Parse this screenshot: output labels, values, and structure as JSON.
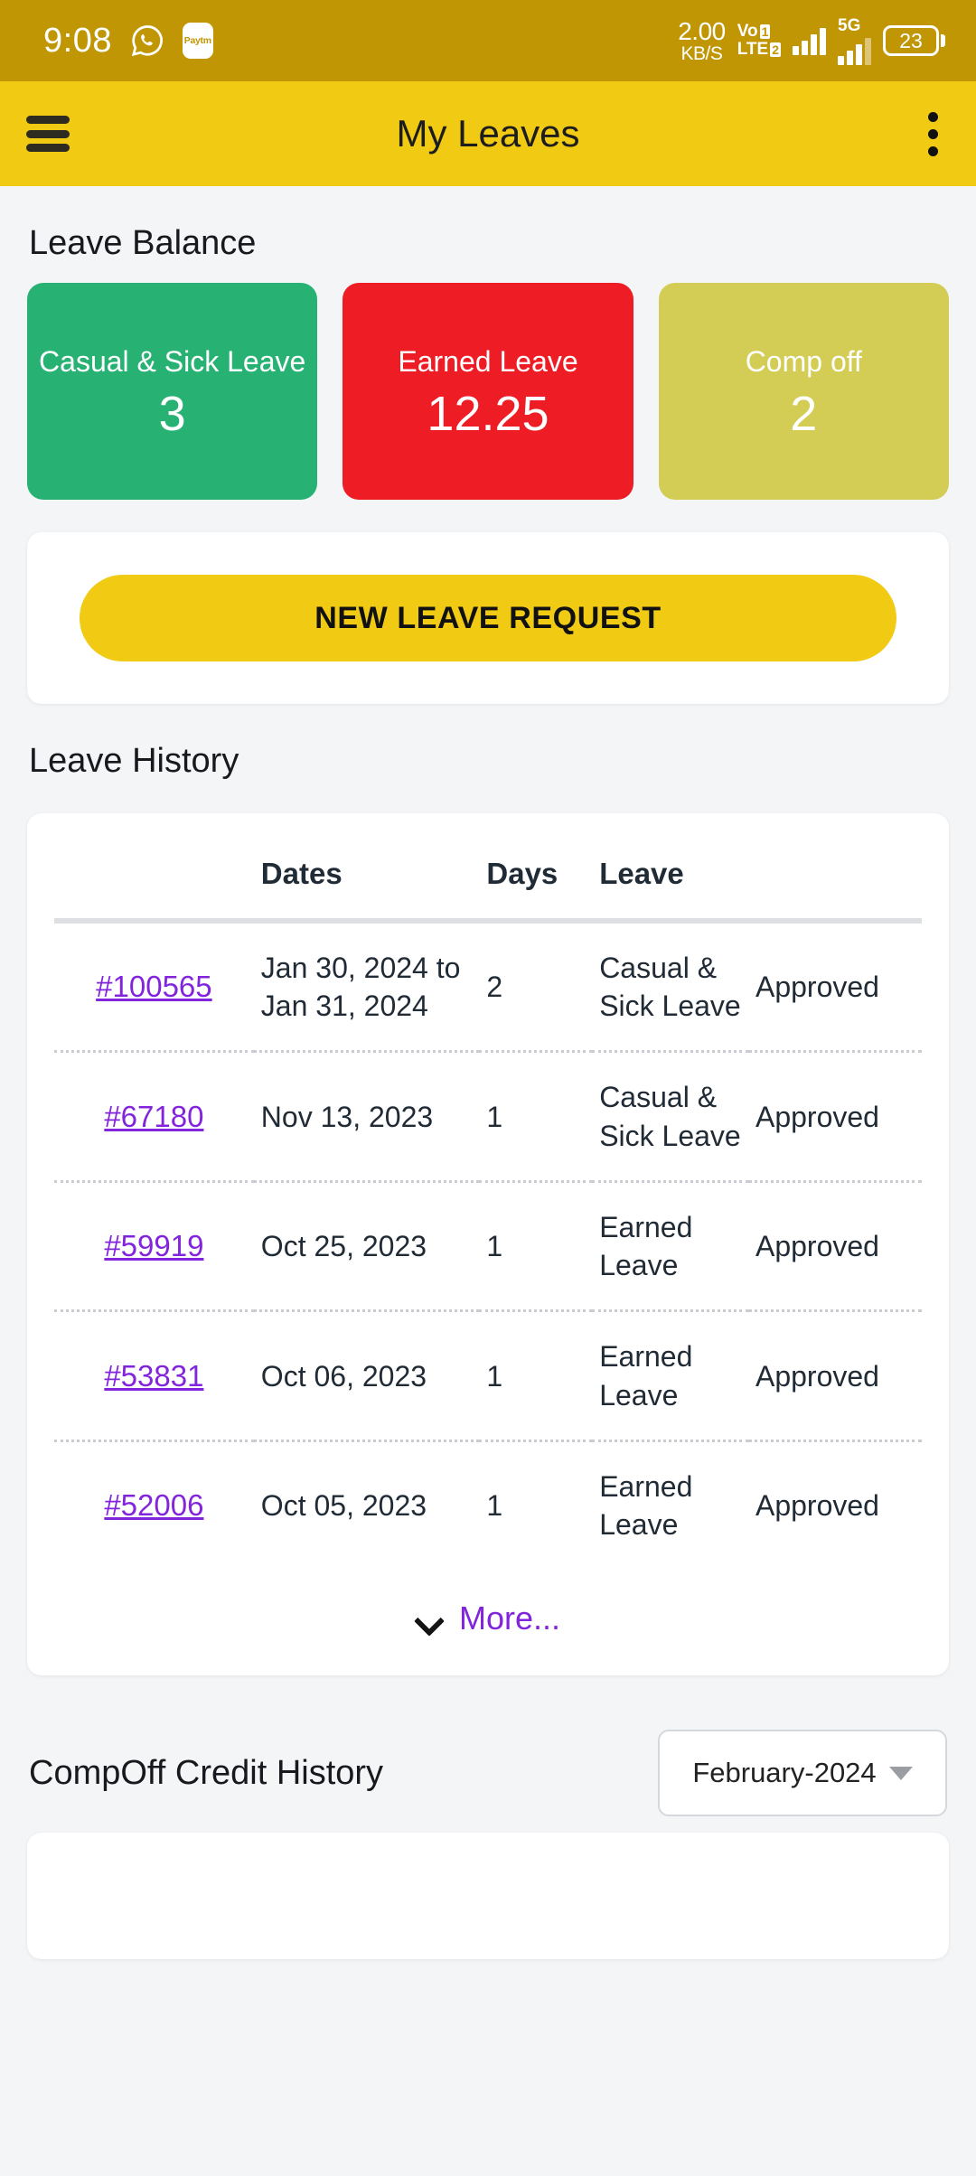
{
  "status_bar": {
    "time": "9:08",
    "whatsapp_icon": "whatsapp-icon",
    "paytm_label": "Paytm",
    "net_speed_value": "2.00",
    "net_speed_unit": "KB/S",
    "volte_line1": "Vo",
    "volte_line2": "LTE",
    "sim1_badge": "1",
    "sim2_badge": "2",
    "network_type": "5G",
    "battery_level": "23"
  },
  "app_bar": {
    "menu_icon": "hamburger-menu-icon",
    "title": "My Leaves",
    "overflow_icon": "kebab-menu-icon"
  },
  "leave_balance": {
    "title": "Leave Balance",
    "cards": [
      {
        "label": "Casual & Sick Leave",
        "value": "3",
        "color": "#27b273"
      },
      {
        "label": "Earned Leave",
        "value": "12.25",
        "color": "#ee1c25"
      },
      {
        "label": "Comp off",
        "value": "2",
        "color": "#d3cc55"
      }
    ]
  },
  "new_leave_request": {
    "button_label": "NEW LEAVE REQUEST",
    "button_color": "#f0ca13"
  },
  "leave_history": {
    "title": "Leave History",
    "columns": [
      "",
      "Dates",
      "Days",
      "Leave",
      ""
    ],
    "rows": [
      {
        "id": "#100565",
        "dates": "Jan 30, 2024 to Jan 31, 2024",
        "days": "2",
        "leave_type": "Casual & Sick Leave",
        "status": "Approved"
      },
      {
        "id": "#67180",
        "dates": "Nov 13, 2023",
        "days": "1",
        "leave_type": "Casual & Sick Leave",
        "status": "Approved"
      },
      {
        "id": "#59919",
        "dates": "Oct 25, 2023",
        "days": "1",
        "leave_type": "Earned Leave",
        "status": "Approved"
      },
      {
        "id": "#53831",
        "dates": "Oct 06, 2023",
        "days": "1",
        "leave_type": "Earned Leave",
        "status": "Approved"
      },
      {
        "id": "#52006",
        "dates": "Oct 05, 2023",
        "days": "1",
        "leave_type": "Earned Leave",
        "status": "Approved"
      }
    ],
    "more_label": "More...",
    "more_icon": "chevron-down-icon",
    "link_color": "#8324dd",
    "status_color": "#5f9c2f"
  },
  "compoff_credit_history": {
    "title": "CompOff Credit History",
    "month_selected": "February-2024",
    "dropdown_icon": "caret-down-icon"
  }
}
